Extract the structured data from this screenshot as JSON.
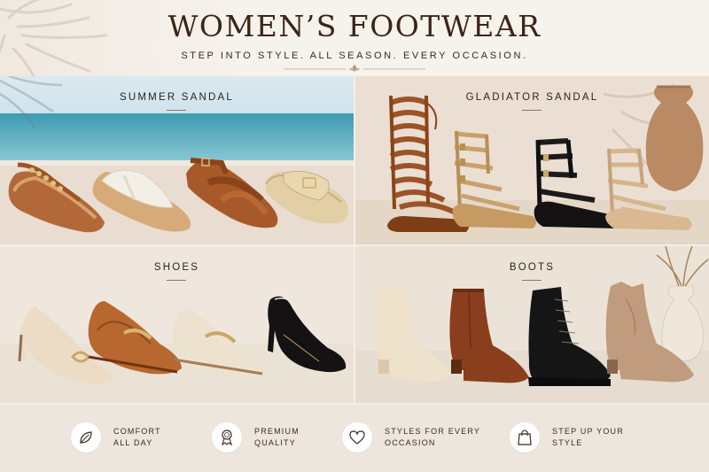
{
  "header": {
    "title": "WOMEN’S FOOTWEAR",
    "subtitle": "STEP INTO STYLE. ALL SEASON. EVERY OCCASION."
  },
  "panels": [
    {
      "id": "summer",
      "label": "SUMMER SANDAL"
    },
    {
      "id": "gladiator",
      "label": "GLADIATOR SANDAL"
    },
    {
      "id": "shoes",
      "label": "SHOES"
    },
    {
      "id": "boots",
      "label": "BOOTS"
    }
  ],
  "features": [
    {
      "icon": "leaf-icon",
      "line1": "COMFORT",
      "line2": "ALL DAY"
    },
    {
      "icon": "award-ribbon-icon",
      "line1": "PREMIUM",
      "line2": "QUALITY"
    },
    {
      "icon": "heart-icon",
      "line1": "STYLES FOR EVERY",
      "line2": "OCCASION"
    },
    {
      "icon": "shopping-bag-icon",
      "line1": "STEP UP YOUR",
      "line2": "STYLE"
    }
  ],
  "colors": {
    "brown": "#8b4a23",
    "tan": "#c99a6a",
    "cream": "#efe6d6",
    "black": "#1c1a1a",
    "sea": "#5fb0c4"
  }
}
